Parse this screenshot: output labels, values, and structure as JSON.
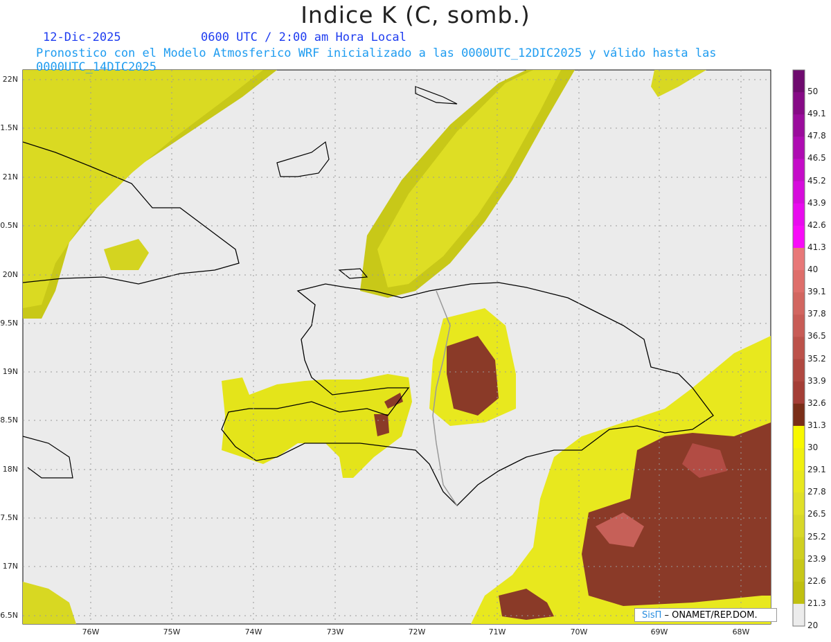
{
  "header": {
    "title": "Indice K (C, somb.)",
    "date": "12-Dic-2025",
    "time": "0600 UTC / 2:00 am Hora Local",
    "description": "Pronostico con el Modelo Atmosferico WRF inicializado a las 0000UTC_12DIC2025 y válido hasta las  0000UTC_14DIC2025"
  },
  "axes": {
    "lat_labels": [
      "22N",
      "1.5N",
      "21N",
      "0.5N",
      "20N",
      "9.5N",
      "19N",
      "8.5N",
      "18N",
      "7.5N",
      "17N",
      "6.5N"
    ],
    "lon_labels": [
      "76W",
      "75W",
      "74W",
      "73W",
      "72W",
      "71W",
      "70W",
      "69W",
      "68W"
    ]
  },
  "colorbar": {
    "labels": [
      "50",
      "49.1",
      "47.8",
      "46.5",
      "45.2",
      "43.9",
      "42.6",
      "41.3",
      "40",
      "39.1",
      "37.8",
      "36.5",
      "35.2",
      "33.9",
      "32.6",
      "31.3",
      "30",
      "29.1",
      "27.8",
      "26.5",
      "25.2",
      "23.9",
      "22.6",
      "21.3",
      "20"
    ],
    "colors": [
      "#6e0a6e",
      "#860a86",
      "#9a0c9c",
      "#ae0cb2",
      "#c40cc8",
      "#d60cdc",
      "#e80cee",
      "#f80cf8",
      "#e87878",
      "#de6e6a",
      "#d26660",
      "#c85c56",
      "#bc524a",
      "#b04840",
      "#a43e36",
      "#7a2e18",
      "#f8f800",
      "#f0f010",
      "#e8e81e",
      "#e0e028",
      "#d8d828",
      "#d0d020",
      "#c8c818",
      "#c0c010",
      "#ececec"
    ]
  },
  "credit": {
    "sis": "SisΠ",
    "rest": " – ONAMET/REP.DOM."
  },
  "colors": {
    "background": "#ebebeb",
    "high": "#8a3a28",
    "mid": "#e4e41a",
    "low": "#c8c814"
  }
}
